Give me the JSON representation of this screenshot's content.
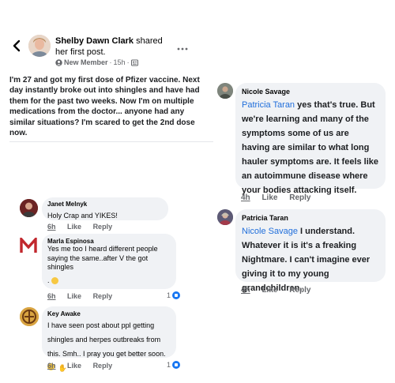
{
  "post": {
    "author": "Shelby Dawn Clark",
    "action": "shared",
    "action_line2": "her first post.",
    "badge": "New Member",
    "time": "15h",
    "body": "I'm 27 and got my first dose of Pfizer vaccine. Next day instantly broke out into shingles and have had them for the past two weeks. Now I'm on multiple medications from the doctor... anyone had any similar situations? I'm scared to get the 2nd dose now."
  },
  "left_comments": [
    {
      "name": "Janet Melnyk",
      "text": "Holy Crap and YIKES!",
      "time": "6h",
      "like": "Like",
      "reply": "Reply"
    },
    {
      "name": "Marla Espinosa",
      "text": "Yes me too I heard different people saying the same..after V the got shingles",
      "text_end": ".",
      "time": "6h",
      "like": "Like",
      "reply": "Reply",
      "reaction_count": "1"
    },
    {
      "name": "Key Awake",
      "text": "I have seen post about ppl getting shingles and herpes outbreaks from this. Smh.. I pray you get better soon.",
      "time": "6h",
      "like": "Like",
      "reply": "Reply",
      "reaction_count": "1"
    }
  ],
  "right_comments": [
    {
      "name": "Nicole Savage",
      "mention": "Patricia Taran",
      "text": " yes that's true. But we're learning and many of the symptoms some of us are having are similar to what long hauler symptoms are. It feels like an autoimmune disease where your bodies attacking itself.",
      "time": "4h",
      "like": "Like",
      "reply": "Reply"
    },
    {
      "name": "Patricia Taran",
      "mention": "Nicole Savage",
      "text": " I understand. Whatever it is it's a freaking Nightmare. I can't imagine ever giving it to my young grandchildren.",
      "time": "4h",
      "like": "Like",
      "reply": "Reply"
    }
  ],
  "icons": {
    "back": "back-arrow-icon",
    "more": "more-options-icon",
    "badge": "new-member-icon",
    "privacy": "group-privacy-icon",
    "reaction": "like-reaction-icon"
  },
  "colors": {
    "link": "#216fdb",
    "bubble": "#f0f2f5",
    "like_blue": "#1877f2"
  }
}
